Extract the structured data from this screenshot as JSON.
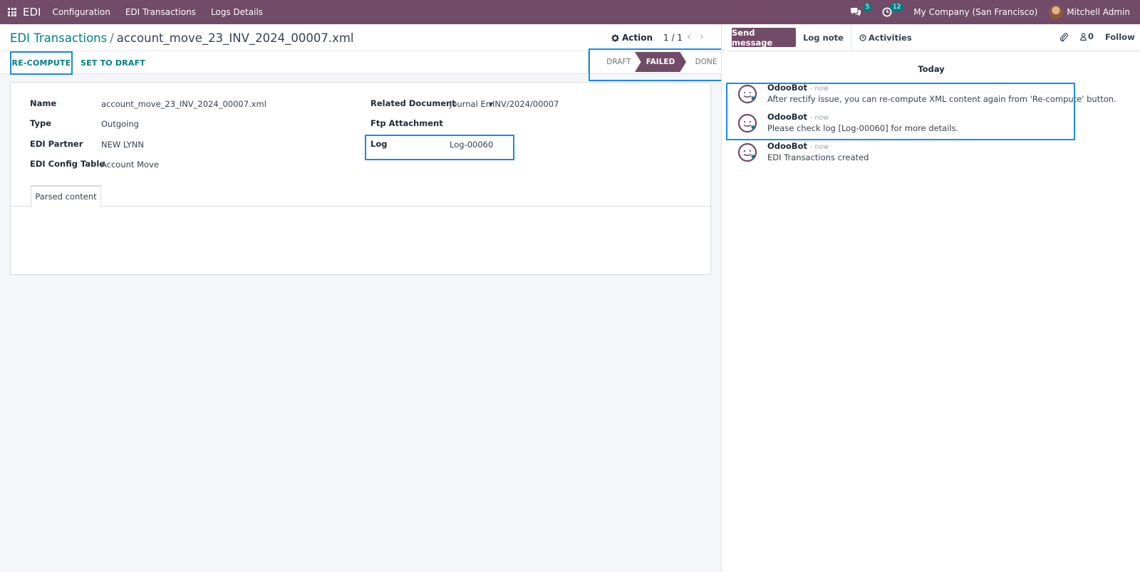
{
  "navbar": {
    "app_name": "EDI",
    "menu": [
      "Configuration",
      "EDI Transactions",
      "Logs Details"
    ],
    "messages_count": "5",
    "activities_count": "12",
    "company": "My Company (San Francisco)",
    "user": "Mitchell Admin"
  },
  "breadcrumb": {
    "parent": "EDI Transactions",
    "separator": "/",
    "current": "account_move_23_INV_2024_00007.xml"
  },
  "control": {
    "action_label": "Action",
    "pager": "1 / 1"
  },
  "buttons": {
    "recompute": "RE-COMPUTE",
    "set_to_draft": "SET TO DRAFT"
  },
  "status": {
    "stages": [
      "DRAFT",
      "FAILED",
      "DONE"
    ],
    "active": "FAILED"
  },
  "form": {
    "name_label": "Name",
    "name_value": "account_move_23_INV_2024_00007.xml",
    "type_label": "Type",
    "type_value": "Outgoing",
    "partner_label": "EDI Partner",
    "partner_value": "NEW LYNN",
    "config_label": "EDI Config Table",
    "config_value": "Account Move",
    "related_label": "Related Document",
    "related_model": "Journal En",
    "related_value": "INV/2024/00007",
    "ftp_label": "Ftp Attachment",
    "log_label": "Log",
    "log_value": "Log-00060",
    "tab_label": "Parsed content"
  },
  "chatter": {
    "send_message": "Send message",
    "log_note": "Log note",
    "activities": "Activities",
    "followers": "0",
    "follow": "Follow",
    "day_label": "Today",
    "messages": [
      {
        "author": "OdooBot",
        "date": "- now",
        "body": "After rectify issue, you can re-compute XML content again from 'Re-compute' button."
      },
      {
        "author": "OdooBot",
        "date": "- now",
        "body": "Please check log [Log-00060] for more details."
      },
      {
        "author": "OdooBot",
        "date": "- now",
        "body": "EDI Transactions created"
      }
    ]
  },
  "colors": {
    "brand": "#714b67",
    "link": "#017e84",
    "highlight": "#1e88e5"
  }
}
